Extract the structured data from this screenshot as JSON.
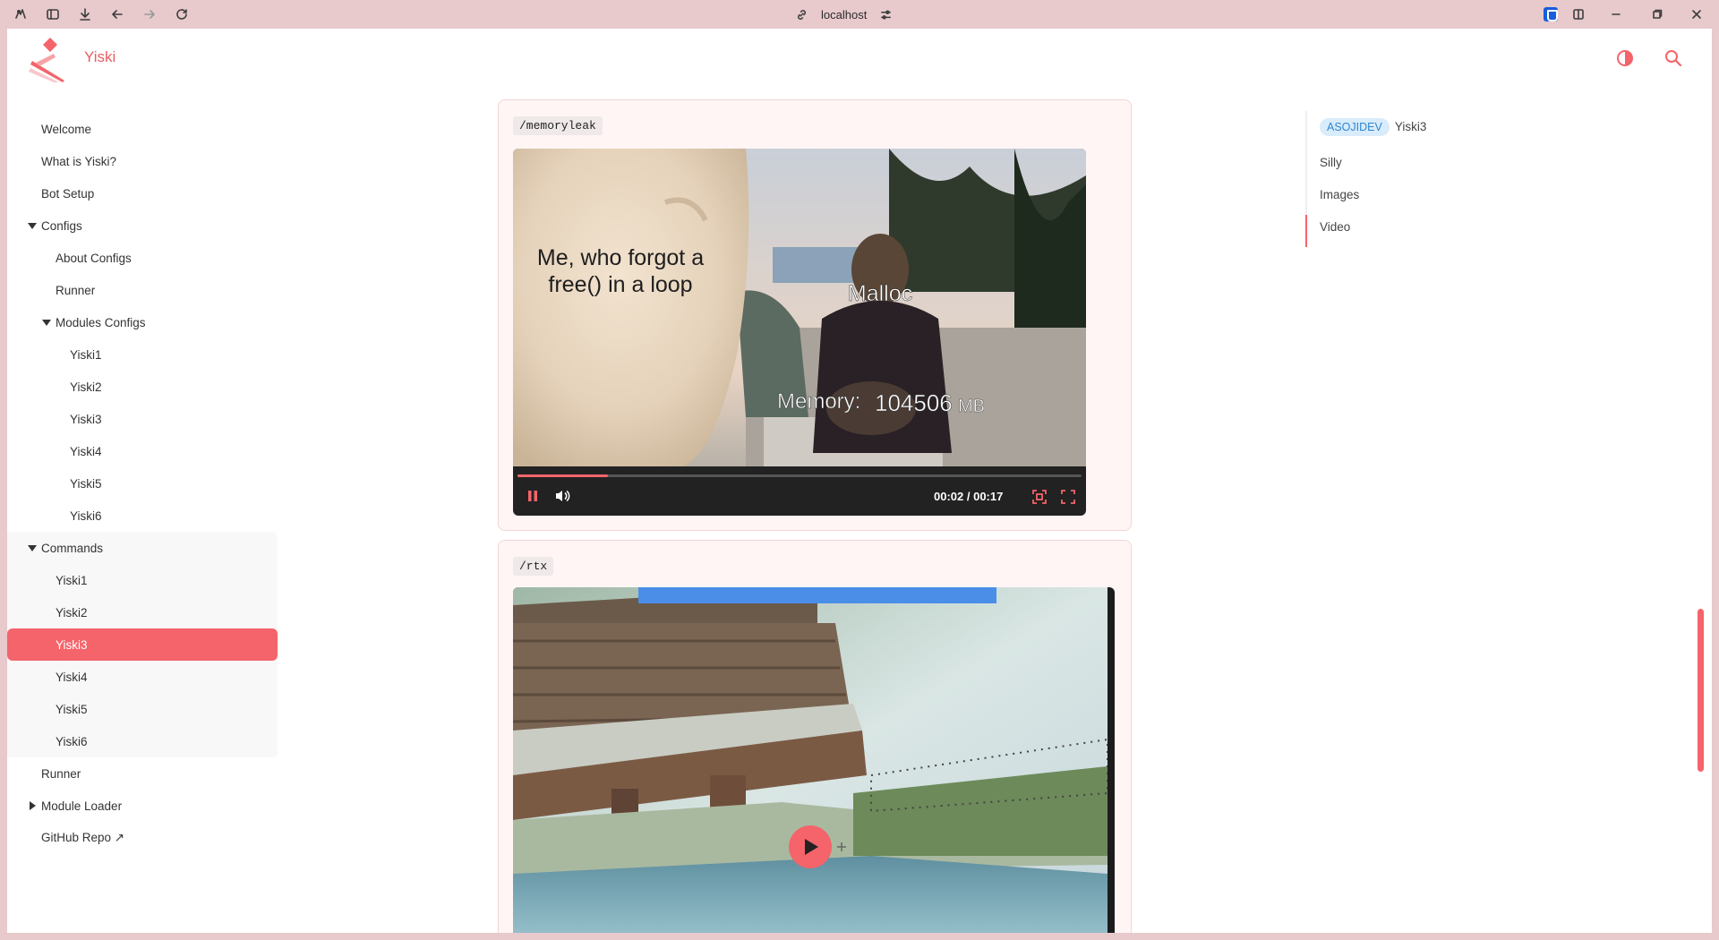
{
  "browser": {
    "address": "localhost",
    "icons": [
      "extensions-icon",
      "sidebar-icon",
      "download-icon",
      "back-icon",
      "forward-icon",
      "reload-icon"
    ],
    "window_icons": [
      "bitwarden-icon",
      "split-view-icon",
      "minimize-icon",
      "maximize-icon",
      "close-icon"
    ]
  },
  "site": {
    "brand": "Yiski",
    "accent": "#f4646a"
  },
  "sidebar": {
    "items": [
      {
        "label": "Welcome"
      },
      {
        "label": "What is Yiski?"
      },
      {
        "label": "Bot Setup"
      },
      {
        "label": "Configs"
      },
      {
        "label": "About Configs"
      },
      {
        "label": "Runner"
      },
      {
        "label": "Modules Configs"
      },
      {
        "label": "Yiski1"
      },
      {
        "label": "Yiski2"
      },
      {
        "label": "Yiski3"
      },
      {
        "label": "Yiski4"
      },
      {
        "label": "Yiski5"
      },
      {
        "label": "Yiski6"
      },
      {
        "label": "Commands"
      },
      {
        "label": "Yiski1"
      },
      {
        "label": "Yiski2"
      },
      {
        "label": "Yiski3"
      },
      {
        "label": "Yiski4"
      },
      {
        "label": "Yiski5"
      },
      {
        "label": "Yiski6"
      },
      {
        "label": "Runner"
      },
      {
        "label": "Module Loader"
      },
      {
        "label": "GitHub Repo ↗"
      }
    ]
  },
  "content": {
    "card1": {
      "command": "/memoryleak",
      "caption_left": "Me, who forgot a free() in a loop",
      "caption_right": "Malloc",
      "memory_label": "Memory:",
      "memory_value": "104506",
      "memory_unit": "MB",
      "time": "00:02 / 00:17",
      "progress": 0.16
    },
    "card2": {
      "command": "/rtx"
    }
  },
  "toc": {
    "tag": "ASOJIDEV",
    "title": "Yiski3",
    "items": [
      "Silly",
      "Images",
      "Video"
    ],
    "active": "Video"
  }
}
